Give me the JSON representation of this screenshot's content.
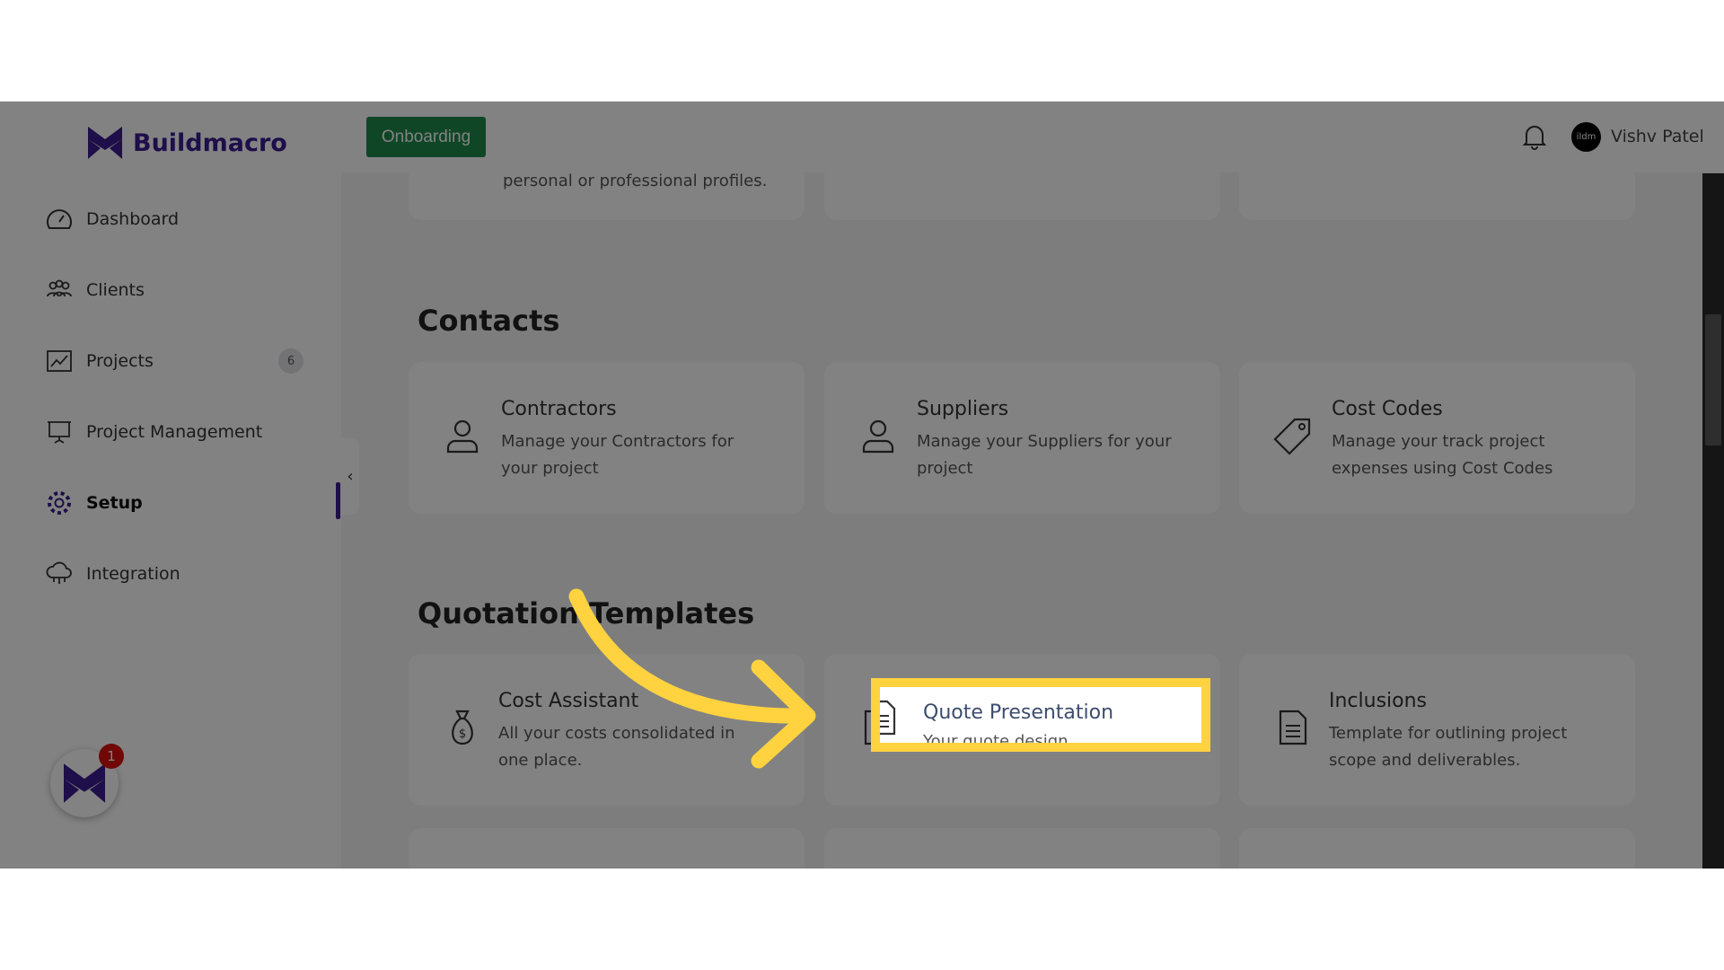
{
  "brand": {
    "name": "Buildmacro",
    "color": "#3b1d8f"
  },
  "header": {
    "onboarding_label": "Onboarding",
    "user_name": "Vishv Patel",
    "avatar_text": "ildm"
  },
  "sidebar": {
    "items": [
      {
        "label": "Dashboard",
        "icon": "gauge-icon"
      },
      {
        "label": "Clients",
        "icon": "users-icon"
      },
      {
        "label": "Projects",
        "icon": "chart-icon",
        "badge": "6"
      },
      {
        "label": "Project Management",
        "icon": "presentation-icon"
      },
      {
        "label": "Setup",
        "icon": "gear-icon",
        "active": true
      },
      {
        "label": "Integration",
        "icon": "cloud-icon"
      }
    ],
    "notification_count": "1"
  },
  "main": {
    "partial_top_text": "personal or professional profiles.",
    "contacts": {
      "heading": "Contacts",
      "cards": [
        {
          "title": "Contractors",
          "desc": "Manage your Contractors for your project",
          "icon": "user-icon"
        },
        {
          "title": "Suppliers",
          "desc": "Manage your Suppliers for your project",
          "icon": "user-icon"
        },
        {
          "title": "Cost Codes",
          "desc": "Manage your track project expenses using Cost Codes",
          "icon": "tag-icon"
        }
      ]
    },
    "quotation": {
      "heading": "Quotation Templates",
      "cards": [
        {
          "title": "Cost Assistant",
          "desc": "All your costs consolidated in one place.",
          "icon": "money-bag-icon"
        },
        {
          "title": "Quote Presentation",
          "desc": "Your quote design",
          "icon": "document-icon"
        },
        {
          "title": "Inclusions",
          "desc": "Template for outlining project scope and deliverables.",
          "icon": "document-icon"
        }
      ]
    }
  },
  "highlight_color": "#ffd23f"
}
